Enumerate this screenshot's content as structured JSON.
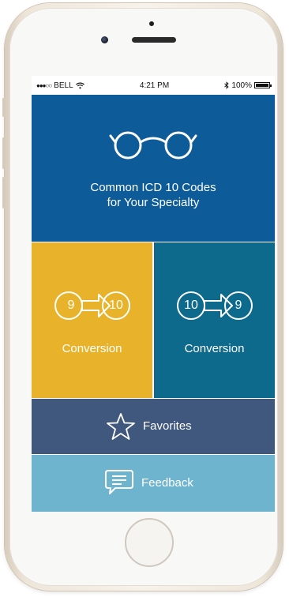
{
  "status_bar": {
    "signal": "●●●○○",
    "carrier": "BELL",
    "wifi_icon": "wifi-icon",
    "time": "4:21 PM",
    "bluetooth_icon": "bluetooth-icon",
    "battery": "100%"
  },
  "tiles": {
    "common": {
      "line1": "Common ICD 10 Codes",
      "line2": "for Your Specialty",
      "icon": "glasses-icon",
      "color": "#0d5c99"
    },
    "nine_to_ten": {
      "from": "9",
      "to": "10",
      "label": "Conversion",
      "icon": "arrow-right-icon",
      "color": "#e8b32a"
    },
    "ten_to_nine": {
      "from": "10",
      "to": "9",
      "label": "Conversion",
      "icon": "arrow-right-icon",
      "color": "#0d6a8c"
    },
    "favorites": {
      "label": "Favorites",
      "icon": "star-icon",
      "color": "#40577e"
    },
    "feedback": {
      "label": "Feedback",
      "icon": "chat-bubble-icon",
      "color": "#6eb4cf"
    }
  }
}
